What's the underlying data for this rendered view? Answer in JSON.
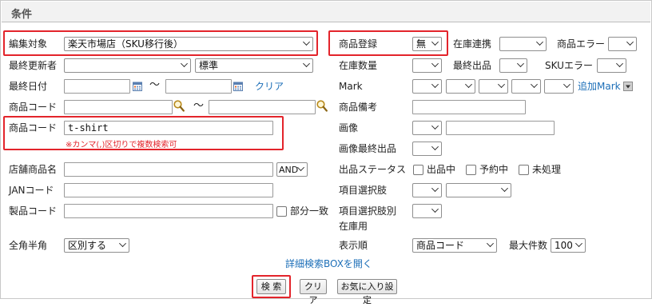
{
  "section": {
    "title": "条件"
  },
  "left": {
    "edit_target": {
      "label": "編集対象",
      "value": "楽天市場店（SKU移行後）"
    },
    "last_updater": {
      "label": "最終更新者",
      "value": "",
      "value2": "標準"
    },
    "last_date": {
      "label": "最終日付",
      "tilde": "〜",
      "clear": "クリア"
    },
    "product_code_range": {
      "label": "商品コード",
      "tilde": "〜"
    },
    "product_code": {
      "label": "商品コード",
      "value": "t-shirt",
      "note": "※カンマ(,)区切りで複数検索可"
    },
    "store_product_name": {
      "label": "店舗商品名",
      "op": "AND"
    },
    "jan_code": {
      "label": "JANコード"
    },
    "maker_code": {
      "label": "製品コード",
      "partial": "部分一致"
    },
    "width": {
      "label": "全角半角",
      "value": "区別する"
    }
  },
  "right": {
    "registered": {
      "label": "商品登録",
      "value": "無"
    },
    "stock_link": {
      "label": "在庫連携",
      "value": ""
    },
    "product_error": {
      "label": "商品エラー",
      "value": ""
    },
    "stock_qty": {
      "label": "在庫数量",
      "value": ""
    },
    "last_listing": {
      "label": "最終出品",
      "value": ""
    },
    "sku_error": {
      "label": "SKUエラー",
      "value": ""
    },
    "mark": {
      "label": "Mark",
      "add": "追加Mark"
    },
    "remarks": {
      "label": "商品備考"
    },
    "image": {
      "label": "画像"
    },
    "image_last": {
      "label": "画像最終出品"
    },
    "status": {
      "label": "出品ステータス",
      "opt1": "出品中",
      "opt2": "予約中",
      "opt3": "未処理"
    },
    "item_option": {
      "label": "項目選択肢"
    },
    "item_option_stock": {
      "label1": "項目選択肢別",
      "label2": "在庫用"
    },
    "order": {
      "label": "表示順",
      "value": "商品コード"
    },
    "max": {
      "label": "最大件数",
      "value": "100"
    }
  },
  "detail_link": "詳細検索BOXを開く",
  "buttons": {
    "search": "検 索",
    "clear": "クリア",
    "favorite": "お気に入り設定"
  }
}
